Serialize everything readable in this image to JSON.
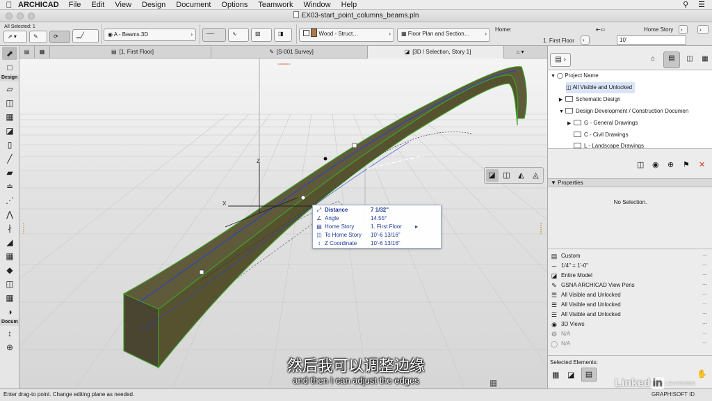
{
  "menubar": {
    "app_name": "ARCHICAD",
    "items": [
      "File",
      "Edit",
      "View",
      "Design",
      "Document",
      "Options",
      "Teamwork",
      "Window",
      "Help"
    ]
  },
  "window": {
    "title": "EX03-start_point_columns_beams.pln"
  },
  "infobox": {
    "selection_label": "All Selected: 1",
    "layer": "A - Beams.3D",
    "material": "Wood - Struct…",
    "floor_plan_section": "Floor Plan and Section…",
    "home_label": "Home:",
    "home_story": "1. First Floor",
    "home_story_label": "Home Story",
    "offset_value": "10'"
  },
  "tabs": [
    {
      "label": "[1. First Floor]"
    },
    {
      "label": "[S-001 Survey]"
    },
    {
      "label": "[3D / Selection, Story 1]"
    }
  ],
  "toolbox": {
    "design_label": "Design",
    "document_label": "Docum"
  },
  "tracker": [
    {
      "key": "Distance",
      "value": "7 1/32\"",
      "icon": "distance-icon"
    },
    {
      "key": "Angle",
      "value": "14.55°",
      "icon": "angle-icon"
    },
    {
      "key": "Home Story",
      "value": "1. First Floor",
      "icon": "home-story-icon"
    },
    {
      "key": "To Home Story",
      "value": "10'-6 13/16\"",
      "icon": "to-home-story-icon"
    },
    {
      "key": "Z Coordinate",
      "value": "10'-6 13/16\"",
      "icon": "z-coordinate-icon"
    }
  ],
  "axes": {
    "x": "X",
    "z": "Z"
  },
  "navigator": {
    "items": [
      {
        "label": "Project Name",
        "level": 0,
        "expanded": true
      },
      {
        "label": "All Visible and Unlocked",
        "level": 1
      },
      {
        "label": "Schematic Design",
        "level": 1,
        "expanded": false
      },
      {
        "label": "Design Development / Construction Documen",
        "level": 1,
        "expanded": true
      },
      {
        "label": "G - General Drawings",
        "level": 2,
        "expanded": false
      },
      {
        "label": "C - Civil Drawings",
        "level": 2
      },
      {
        "label": "L - Landscape Drawings",
        "level": 2
      }
    ]
  },
  "properties": {
    "header": "Properties",
    "empty_text": "No Selection."
  },
  "quick_options": [
    {
      "label": "Custom",
      "icon": "structure-icon"
    },
    {
      "label": "1/4\"    =    1'-0\"",
      "icon": "scale-icon"
    },
    {
      "label": "Entire Model",
      "icon": "model-icon"
    },
    {
      "label": "GSNA ARCHICAD View Pens",
      "icon": "pen-icon"
    },
    {
      "label": "All Visible and Unlocked",
      "icon": "layer-icon"
    },
    {
      "label": "All Visible and Unlocked",
      "icon": "layer-icon"
    },
    {
      "label": "All Visible and Unlocked",
      "icon": "layer-icon"
    },
    {
      "label": "3D Views",
      "icon": "3d-views-icon"
    },
    {
      "label": "N/A",
      "icon": "graphic-override-icon",
      "dim": true
    },
    {
      "label": "N/A",
      "icon": "renovation-icon",
      "dim": true
    }
  ],
  "selected_elements_label": "Selected Elements:",
  "status": "Enter drag-to point. Change editing plane as needed.",
  "subtitle": {
    "chinese": "然后我可以调整边缘",
    "english": "and then I can adjust the edges"
  },
  "watermark": {
    "linked": "Linked",
    "in": "in",
    "learning": "LEARNING",
    "graphisoft": "GRAPHISOFT ID"
  }
}
